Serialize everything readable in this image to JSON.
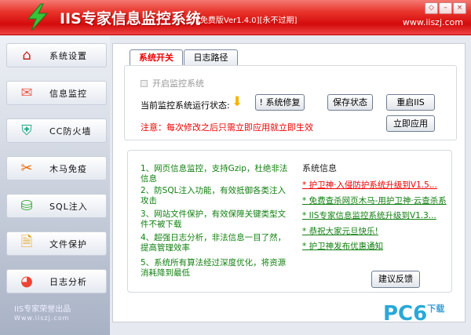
{
  "header": {
    "title": "IIS专家信息监控系统",
    "version": "[免费版Ver1.4.0][永不过期]",
    "site": "www.iiszj.com",
    "window_buttons": [
      "◇",
      "–",
      "×"
    ]
  },
  "sidebar": {
    "items": [
      {
        "label": "系统设置",
        "icon": "house-icon"
      },
      {
        "label": "信息监控",
        "icon": "chat-icon"
      },
      {
        "label": "CC防火墙",
        "icon": "shield-icon"
      },
      {
        "label": "木马免疫",
        "icon": "tools-icon"
      },
      {
        "label": "SQL注入",
        "icon": "database-icon"
      },
      {
        "label": "文件保护",
        "icon": "file-lock-icon"
      },
      {
        "label": "日志分析",
        "icon": "chart-icon"
      }
    ],
    "brand": "IIS专家荣誉出品",
    "brand_url": "Www.iiszj.com"
  },
  "tabs": [
    {
      "label": "系统开关",
      "active": true
    },
    {
      "label": "日志路径",
      "active": false
    }
  ],
  "control": {
    "checkbox_label": "开启监控系统",
    "status_label": "当前监控系统运行状态:",
    "repair_button": "! 系统修复",
    "save_button": "保存状态",
    "restart_button": "重启IIS",
    "apply_button": "立即应用",
    "note": "注意：每次修改之后只需立即应用就立即生效"
  },
  "features": [
    "1、网页信息监控，支持Gzip，杜绝非法信息",
    "2、防SQL注入功能，有效抵御各类注入攻击",
    "3、网站文件保护，有效保障关键类型文件不被下载",
    "4、超强日志分析，非法信息一目了然，提高管理效率",
    "5、系统所有算法经过深度优化，将资源消耗降到最低"
  ],
  "sysinfo": {
    "title": "系统信息",
    "news": [
      "* 护卫神·入侵防护系统升级到V1.5...",
      "* 免费查杀网页木马-用护卫神·云查杀系",
      "* IIS专家信息监控系统升级到V1.3...",
      "* 恭祝大家元旦快乐!",
      "* 护卫神发布优惠通知"
    ],
    "feedback_button": "建议反馈"
  },
  "watermark": {
    "text": "PC6",
    "sub": "下载"
  },
  "colors": {
    "title_red": "#d40b0b",
    "feature_green": "#128012",
    "news_red": "#e00000",
    "news_green": "#128012"
  }
}
